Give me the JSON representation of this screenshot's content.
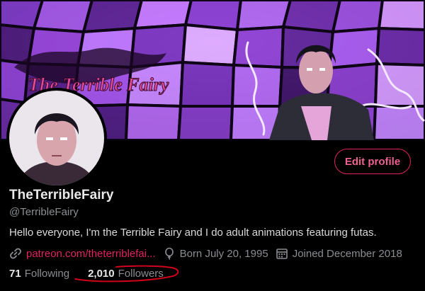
{
  "banner": {
    "logo_text": "The Terrible Fairy"
  },
  "profile": {
    "display_name": "TheTerribleFairy",
    "handle": "@TerribleFairy",
    "bio": "Hello everyone, I'm the Terrible Fairy and I do adult animations featuring futas.",
    "edit_button": "Edit profile"
  },
  "meta": {
    "website": "patreon.com/theterriblefai...",
    "birthday": "Born July 20, 1995",
    "joined": "Joined December 2018"
  },
  "stats": {
    "following_count": "71",
    "following_label": "Following",
    "followers_count": "2,010",
    "followers_label": "Followers"
  },
  "colors": {
    "accent": "#e0245e",
    "background": "#000000",
    "muted_text": "#8a8d91",
    "annotation": "#d0021b"
  },
  "icons": [
    "link-icon",
    "balloon-icon",
    "calendar-icon"
  ]
}
